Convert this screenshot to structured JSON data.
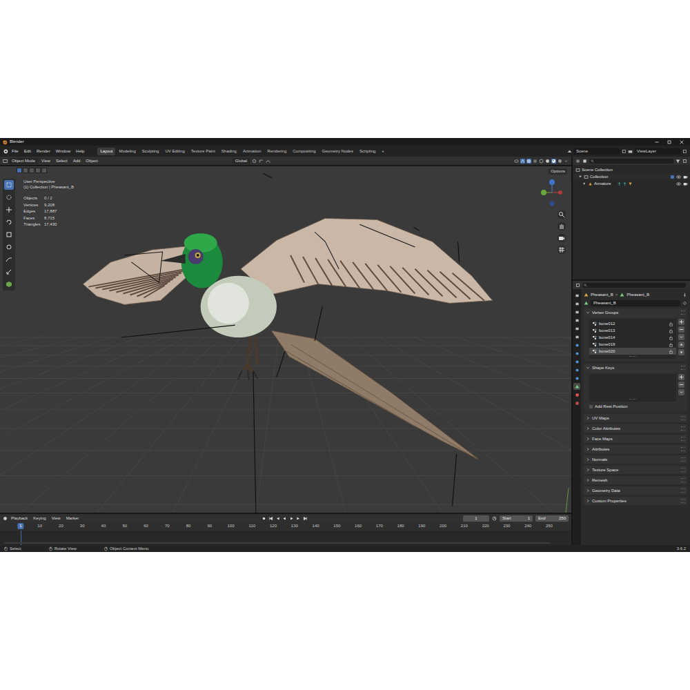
{
  "window": {
    "title": "Blender",
    "version": "3.6.2"
  },
  "menu": [
    "File",
    "Edit",
    "Render",
    "Window",
    "Help"
  ],
  "workspaces": [
    {
      "label": "Layout",
      "selected": true
    },
    {
      "label": "Modeling",
      "selected": false
    },
    {
      "label": "Sculpting",
      "selected": false
    },
    {
      "label": "UV Editing",
      "selected": false
    },
    {
      "label": "Texture Paint",
      "selected": false
    },
    {
      "label": "Shading",
      "selected": false
    },
    {
      "label": "Animation",
      "selected": false
    },
    {
      "label": "Rendering",
      "selected": false
    },
    {
      "label": "Compositing",
      "selected": false
    },
    {
      "label": "Geometry Nodes",
      "selected": false
    },
    {
      "label": "Scripting",
      "selected": false
    }
  ],
  "add_workspace": "+",
  "scene": "Scene",
  "view_layer": "ViewLayer",
  "viewport": {
    "mode": "Object Mode",
    "menus": [
      "View",
      "Select",
      "Add",
      "Object"
    ],
    "orientation": "Global",
    "options": "Options",
    "view_name": "User Perspective",
    "context": "(1) Collection | Pheasant_B",
    "stats": [
      {
        "label": "Objects",
        "value": "0 / 2"
      },
      {
        "label": "Vertices",
        "value": "9,208"
      },
      {
        "label": "Edges",
        "value": "17,887"
      },
      {
        "label": "Faces",
        "value": "8,715"
      },
      {
        "label": "Triangles",
        "value": "17,430"
      }
    ]
  },
  "toolbar": [
    {
      "selected": true
    },
    {
      "selected": false
    },
    {
      "selected": false
    },
    {
      "selected": false
    },
    {
      "selected": false
    },
    {
      "selected": false
    },
    {
      "selected": false
    },
    {
      "selected": false
    },
    {
      "selected": false
    }
  ],
  "outliner": {
    "items": [
      {
        "label": "Scene Collection",
        "kind": "scene",
        "expanded": true,
        "visible": true
      },
      {
        "label": "Collection",
        "kind": "collection",
        "expanded": true,
        "visible": true
      },
      {
        "label": "Armature",
        "kind": "object",
        "expanded": false,
        "visible": true
      }
    ]
  },
  "property_tabs": [
    {
      "selected": false
    },
    {
      "selected": false
    },
    {
      "selected": false
    },
    {
      "selected": false
    },
    {
      "selected": false
    },
    {
      "selected": false
    },
    {
      "selected": false
    },
    {
      "selected": false
    },
    {
      "selected": false
    },
    {
      "selected": false
    },
    {
      "selected": false
    },
    {
      "selected": true
    },
    {
      "selected": false
    },
    {
      "selected": false
    }
  ],
  "properties": {
    "breadcrumb": [
      "Pheasant_B",
      "Pheasant_B"
    ],
    "separator": ">",
    "name": "Pheasant_B",
    "vertex_groups": [
      {
        "name": "bone012",
        "selected": false
      },
      {
        "name": "bone013",
        "selected": false
      },
      {
        "name": "bone014",
        "selected": false
      },
      {
        "name": "bone019",
        "selected": false
      },
      {
        "name": "bone020",
        "selected": true
      }
    ],
    "rest_position": {
      "label": "Add Rest Position",
      "checked": false
    },
    "panels": [
      {
        "label": "Vertex Groups",
        "kind": "vertex-groups",
        "expanded": true
      },
      {
        "label": "Shape Keys",
        "kind": "shape-keys",
        "expanded": true
      },
      {
        "label": "UV Maps",
        "kind": "plain",
        "expanded": false
      },
      {
        "label": "Color Attributes",
        "kind": "plain",
        "expanded": false
      },
      {
        "label": "Face Maps",
        "kind": "plain",
        "expanded": false
      },
      {
        "label": "Attributes",
        "kind": "plain",
        "expanded": false
      },
      {
        "label": "Normals",
        "kind": "plain",
        "expanded": false
      },
      {
        "label": "Texture Space",
        "kind": "plain",
        "expanded": false
      },
      {
        "label": "Remesh",
        "kind": "plain",
        "expanded": false
      },
      {
        "label": "Geometry Data",
        "kind": "plain",
        "expanded": false
      },
      {
        "label": "Custom Properties",
        "kind": "plain",
        "expanded": false
      }
    ]
  },
  "timeline": {
    "menus": [
      "Playback",
      "Keying",
      "View",
      "Marker"
    ],
    "current": "1",
    "start_label": "Start",
    "start": "1",
    "end_label": "End",
    "end": "250",
    "ticks": [
      "10",
      "20",
      "30",
      "40",
      "50",
      "60",
      "70",
      "80",
      "90",
      "100",
      "110",
      "120",
      "130",
      "140",
      "150",
      "160",
      "170",
      "180",
      "190",
      "200",
      "210",
      "220",
      "230",
      "240",
      "250"
    ]
  },
  "status": [
    {
      "label": "Select"
    },
    {
      "label": "Rotate View"
    },
    {
      "label": "Object Context Menu"
    }
  ]
}
